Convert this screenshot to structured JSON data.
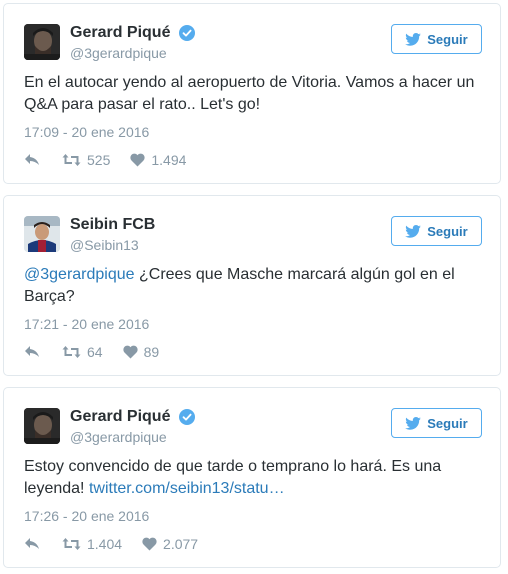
{
  "tweets": [
    {
      "user": {
        "display_name": "Gerard Piqué",
        "handle": "@3gerardpique",
        "verified": true
      },
      "follow_label": "Seguir",
      "text": "En el autocar yendo al aeropuerto de Vitoria. Vamos a hacer un Q&A para pasar el rato.. Let's go!",
      "timestamp": "17:09 - 20 ene 2016",
      "retweets": "525",
      "likes": "1.494"
    },
    {
      "user": {
        "display_name": "Seibin FCB",
        "handle": "@Seibin13",
        "verified": false
      },
      "follow_label": "Seguir",
      "mention": "@3gerardpique",
      "text": " ¿Crees que Masche marcará algún gol en el Barça?",
      "timestamp": "17:21 - 20 ene 2016",
      "retweets": "64",
      "likes": "89"
    },
    {
      "user": {
        "display_name": "Gerard Piqué",
        "handle": "@3gerardpique",
        "verified": true
      },
      "follow_label": "Seguir",
      "text": "Estoy convencido de que tarde o temprano lo hará. Es una leyenda! ",
      "link": "twitter.com/seibin13/statu…",
      "timestamp": "17:26 - 20 ene 2016",
      "retweets": "1.404",
      "likes": "2.077"
    }
  ],
  "icons": {
    "verified": "verified-badge-icon",
    "follow": "twitter-bird-icon",
    "reply": "reply-icon",
    "retweet": "retweet-icon",
    "like": "heart-icon"
  },
  "colors": {
    "accent": "#2b7bb9",
    "verified": "#55acee",
    "muted": "#8899a6",
    "text": "#292f33",
    "border": "#e1e8ed"
  }
}
